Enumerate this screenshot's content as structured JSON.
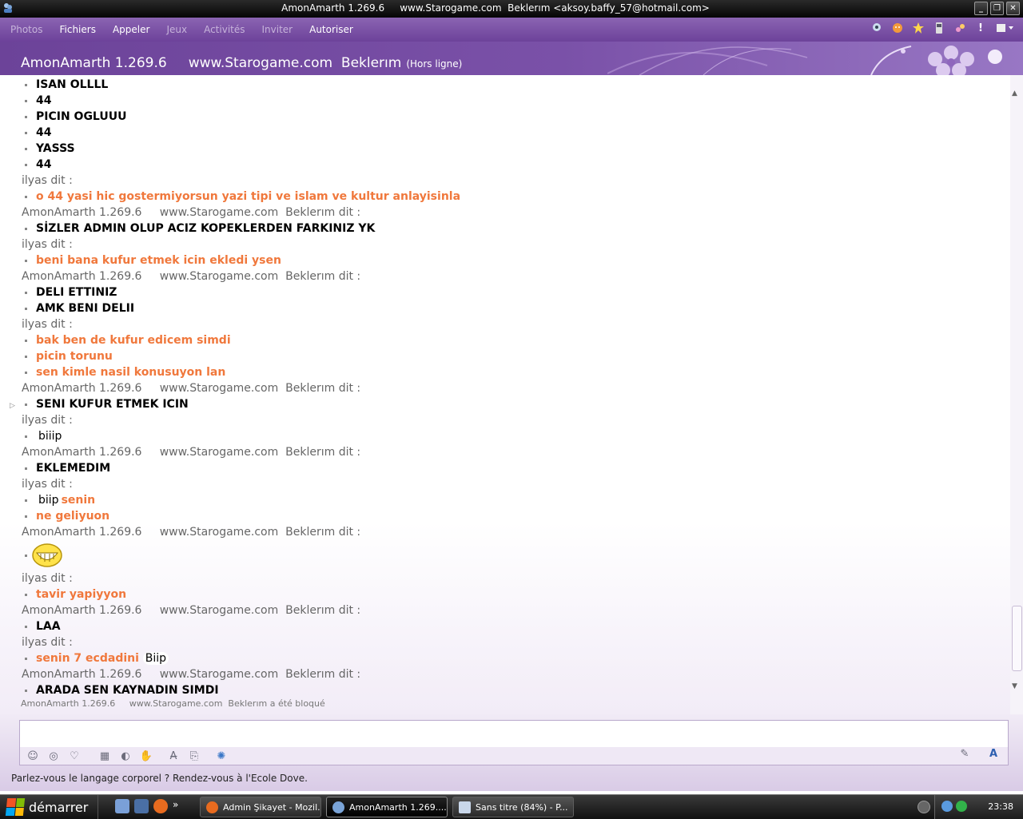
{
  "window": {
    "title": "AmonAmarth 1.269.6     www.Starogame.com  Beklerım <aksoy.baffy_57@hotmail.com>",
    "buttons": [
      "_",
      "❐",
      "✕"
    ]
  },
  "menu": {
    "items": [
      "Photos",
      "Fichiers",
      "Appeler",
      "Jeux",
      "Activités",
      "Inviter",
      "Autoriser"
    ]
  },
  "header": {
    "contact_name": "AmonAmarth 1.269.6     www.Starogame.com  Beklerım",
    "status": "(Hors ligne)"
  },
  "conversation": {
    "rows": [
      {
        "type": "msg",
        "text": "ISAN OLLLL",
        "color": "black"
      },
      {
        "type": "msg",
        "text": "44",
        "color": "black"
      },
      {
        "type": "msg",
        "text": "PICIN OGLUUU",
        "color": "black"
      },
      {
        "type": "msg",
        "text": "44",
        "color": "black"
      },
      {
        "type": "msg",
        "text": "YASSS",
        "color": "black"
      },
      {
        "type": "msg",
        "text": "44",
        "color": "black"
      },
      {
        "type": "sender",
        "text": "ilyas dit :"
      },
      {
        "type": "msg",
        "text": "o 44 yasi hic gostermiyorsun yazi tipi ve islam ve kultur anlayisinla",
        "color": "orange"
      },
      {
        "type": "sender",
        "text": "AmonAmarth 1.269.6     www.Starogame.com  Beklerım dit :"
      },
      {
        "type": "msg",
        "text": "SİZLER ADMIN OLUP ACIZ KOPEKLERDEN FARKINIZ YK",
        "color": "black"
      },
      {
        "type": "sender",
        "text": "ilyas dit :"
      },
      {
        "type": "msg",
        "text": "beni bana kufur etmek icin ekledi ysen",
        "color": "orange"
      },
      {
        "type": "sender",
        "text": "AmonAmarth 1.269.6     www.Starogame.com  Beklerım dit :"
      },
      {
        "type": "msg",
        "text": "DELI ETTINIZ",
        "color": "black"
      },
      {
        "type": "msg",
        "text": "AMK BENI DELII",
        "color": "black"
      },
      {
        "type": "sender",
        "text": "ilyas dit :"
      },
      {
        "type": "msg",
        "text": "bak ben de kufur edicem simdi",
        "color": "orange"
      },
      {
        "type": "msg",
        "text": "picin torunu",
        "color": "orange"
      },
      {
        "type": "msg",
        "text": "sen kimle nasil konusuyon lan",
        "color": "orange"
      },
      {
        "type": "sender",
        "text": "AmonAmarth 1.269.6     www.Starogame.com  Beklerım dit :"
      },
      {
        "type": "msg",
        "text": "SENI KUFUR ETMEK ICIN",
        "color": "black"
      },
      {
        "type": "sender",
        "text": "ilyas dit :"
      },
      {
        "type": "msg",
        "text": "",
        "color": "black",
        "censor": "biiip"
      },
      {
        "type": "sender",
        "text": "AmonAmarth 1.269.6     www.Starogame.com  Beklerım dit :"
      },
      {
        "type": "msg",
        "text": "EKLEMEDIM",
        "color": "black"
      },
      {
        "type": "sender",
        "text": "ilyas dit :"
      },
      {
        "type": "msg",
        "text": "senin",
        "color": "orange",
        "censor": "biip"
      },
      {
        "type": "msg",
        "text": "ne geliyuon",
        "color": "orange"
      },
      {
        "type": "sender",
        "text": "AmonAmarth 1.269.6     www.Starogame.com  Beklerım dit :"
      },
      {
        "type": "emoticon",
        "name": "grin-emoticon"
      },
      {
        "type": "sender",
        "text": "ilyas dit :"
      },
      {
        "type": "msg",
        "text": "tavir yapiyyon",
        "color": "orange"
      },
      {
        "type": "sender",
        "text": "AmonAmarth 1.269.6     www.Starogame.com  Beklerım dit :"
      },
      {
        "type": "msg",
        "text": "LAA",
        "color": "black"
      },
      {
        "type": "sender",
        "text": "ilyas dit :"
      },
      {
        "type": "msg",
        "text": "senin 7 ecdadini",
        "color": "orange",
        "censor_after": "Biip"
      },
      {
        "type": "sender",
        "text": "AmonAmarth 1.269.6     www.Starogame.com  Beklerım dit :"
      },
      {
        "type": "msg",
        "text": "ARADA SEN KAYNADIN SIMDI",
        "color": "black"
      }
    ],
    "blocked_notice": "AmonAmarth 1.269.6     www.Starogame.com  Beklerım a été bloqué"
  },
  "composer": {
    "input_value": "",
    "ad_text": "Parlez-vous le langage corporel ? Rendez-vous à l'Ecole Dove."
  },
  "taskbar": {
    "start_label": "démarrer",
    "tasks": [
      "Admin Şikayet - Mozil...",
      "AmonAmarth 1.269....",
      "Sans titre (84%) - P..."
    ],
    "active_task": 1,
    "clock": "23:38"
  },
  "colors": {
    "purple": "#6d429a",
    "orange_text": "#f0783c"
  }
}
